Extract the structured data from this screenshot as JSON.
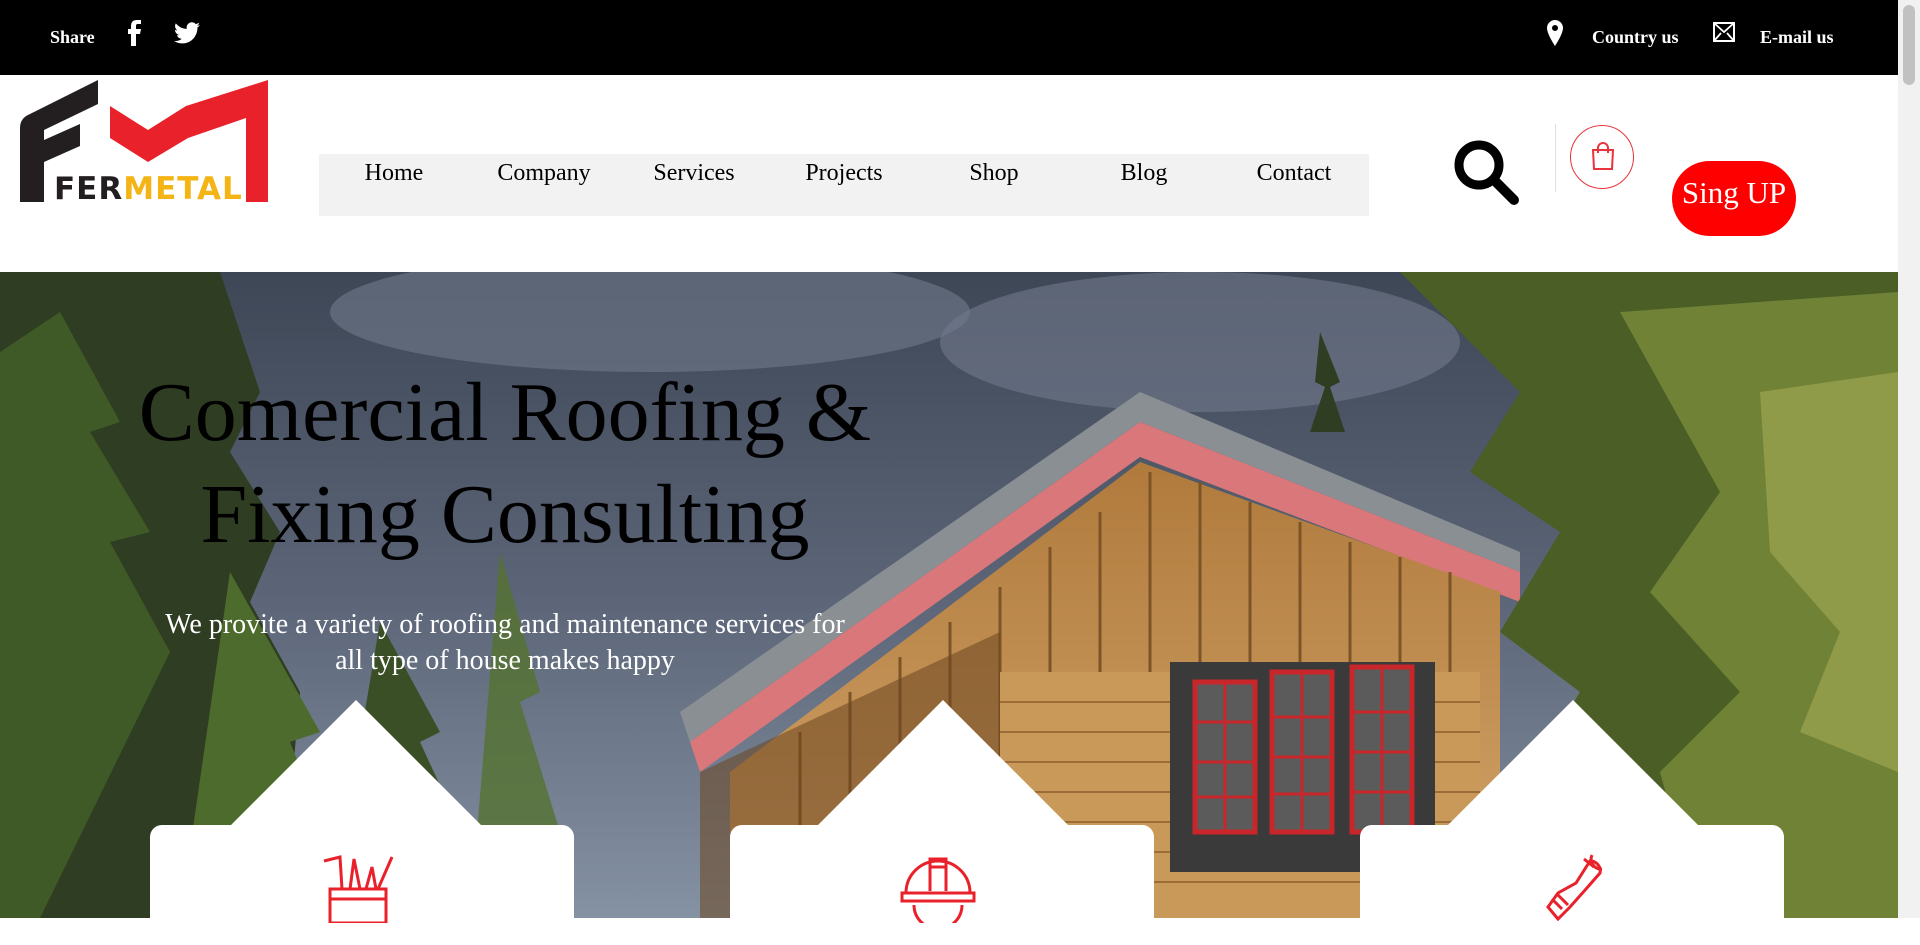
{
  "topbar": {
    "share_label": "Share",
    "social": [
      "facebook-icon",
      "twitter-icon"
    ],
    "country_label": "Country us",
    "email_label": "E-mail us"
  },
  "brand": {
    "logo_parts": [
      "FER",
      "METAL"
    ],
    "colors": {
      "accent": "#ff0000",
      "logo_dark": "#231f20",
      "logo_red": "#e8212a",
      "logo_yellow": "#f4b416"
    }
  },
  "nav": {
    "items": [
      "Home",
      "Company",
      "Services",
      "Projects",
      "Shop",
      "Blog",
      "Contact"
    ]
  },
  "header_actions": {
    "search_icon": "search-icon",
    "cart_icon": "shopping-bag-icon",
    "signup_label": "Sing UP"
  },
  "hero": {
    "title_line1": "Comercial Roofing &",
    "title_line2": "Fixing Consulting",
    "subtitle_line1": "We provite a variety of roofing and maintenance services for",
    "subtitle_line2": "all type of house makes happy"
  },
  "cards": {
    "icons": [
      "tools-cup-icon",
      "hard-hat-icon",
      "wrench-hand-icon"
    ]
  }
}
